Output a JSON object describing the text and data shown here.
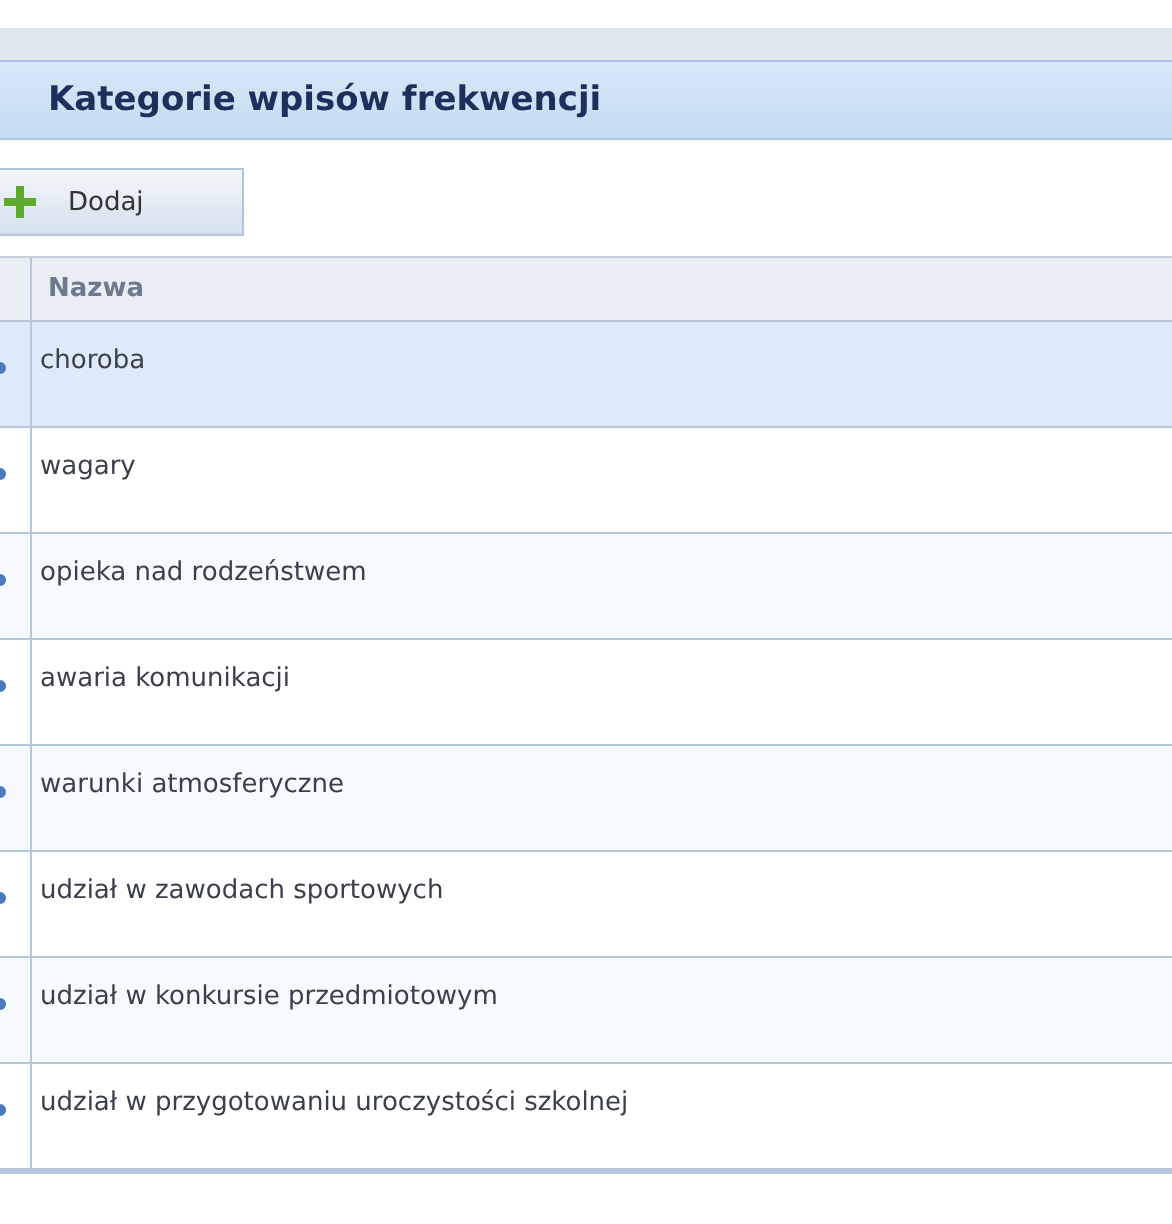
{
  "panel": {
    "title": "Kategorie wpisów frekwencji"
  },
  "toolbar": {
    "buttons": [
      {
        "label": "Dodaj"
      }
    ]
  },
  "table": {
    "columns": [
      "Nazwa"
    ],
    "rows": [
      {
        "name": "choroba",
        "selected": true
      },
      {
        "name": "wagary",
        "selected": false
      },
      {
        "name": "opieka nad rodzeństwem",
        "selected": false
      },
      {
        "name": "awaria komunikacji",
        "selected": false
      },
      {
        "name": "warunki atmosferyczne",
        "selected": false
      },
      {
        "name": "udział w zawodach sportowych",
        "selected": false
      },
      {
        "name": "udział w konkursie przedmiotowym",
        "selected": false
      },
      {
        "name": "udział w przygotowaniu uroczystości szkolnej",
        "selected": false
      }
    ]
  }
}
